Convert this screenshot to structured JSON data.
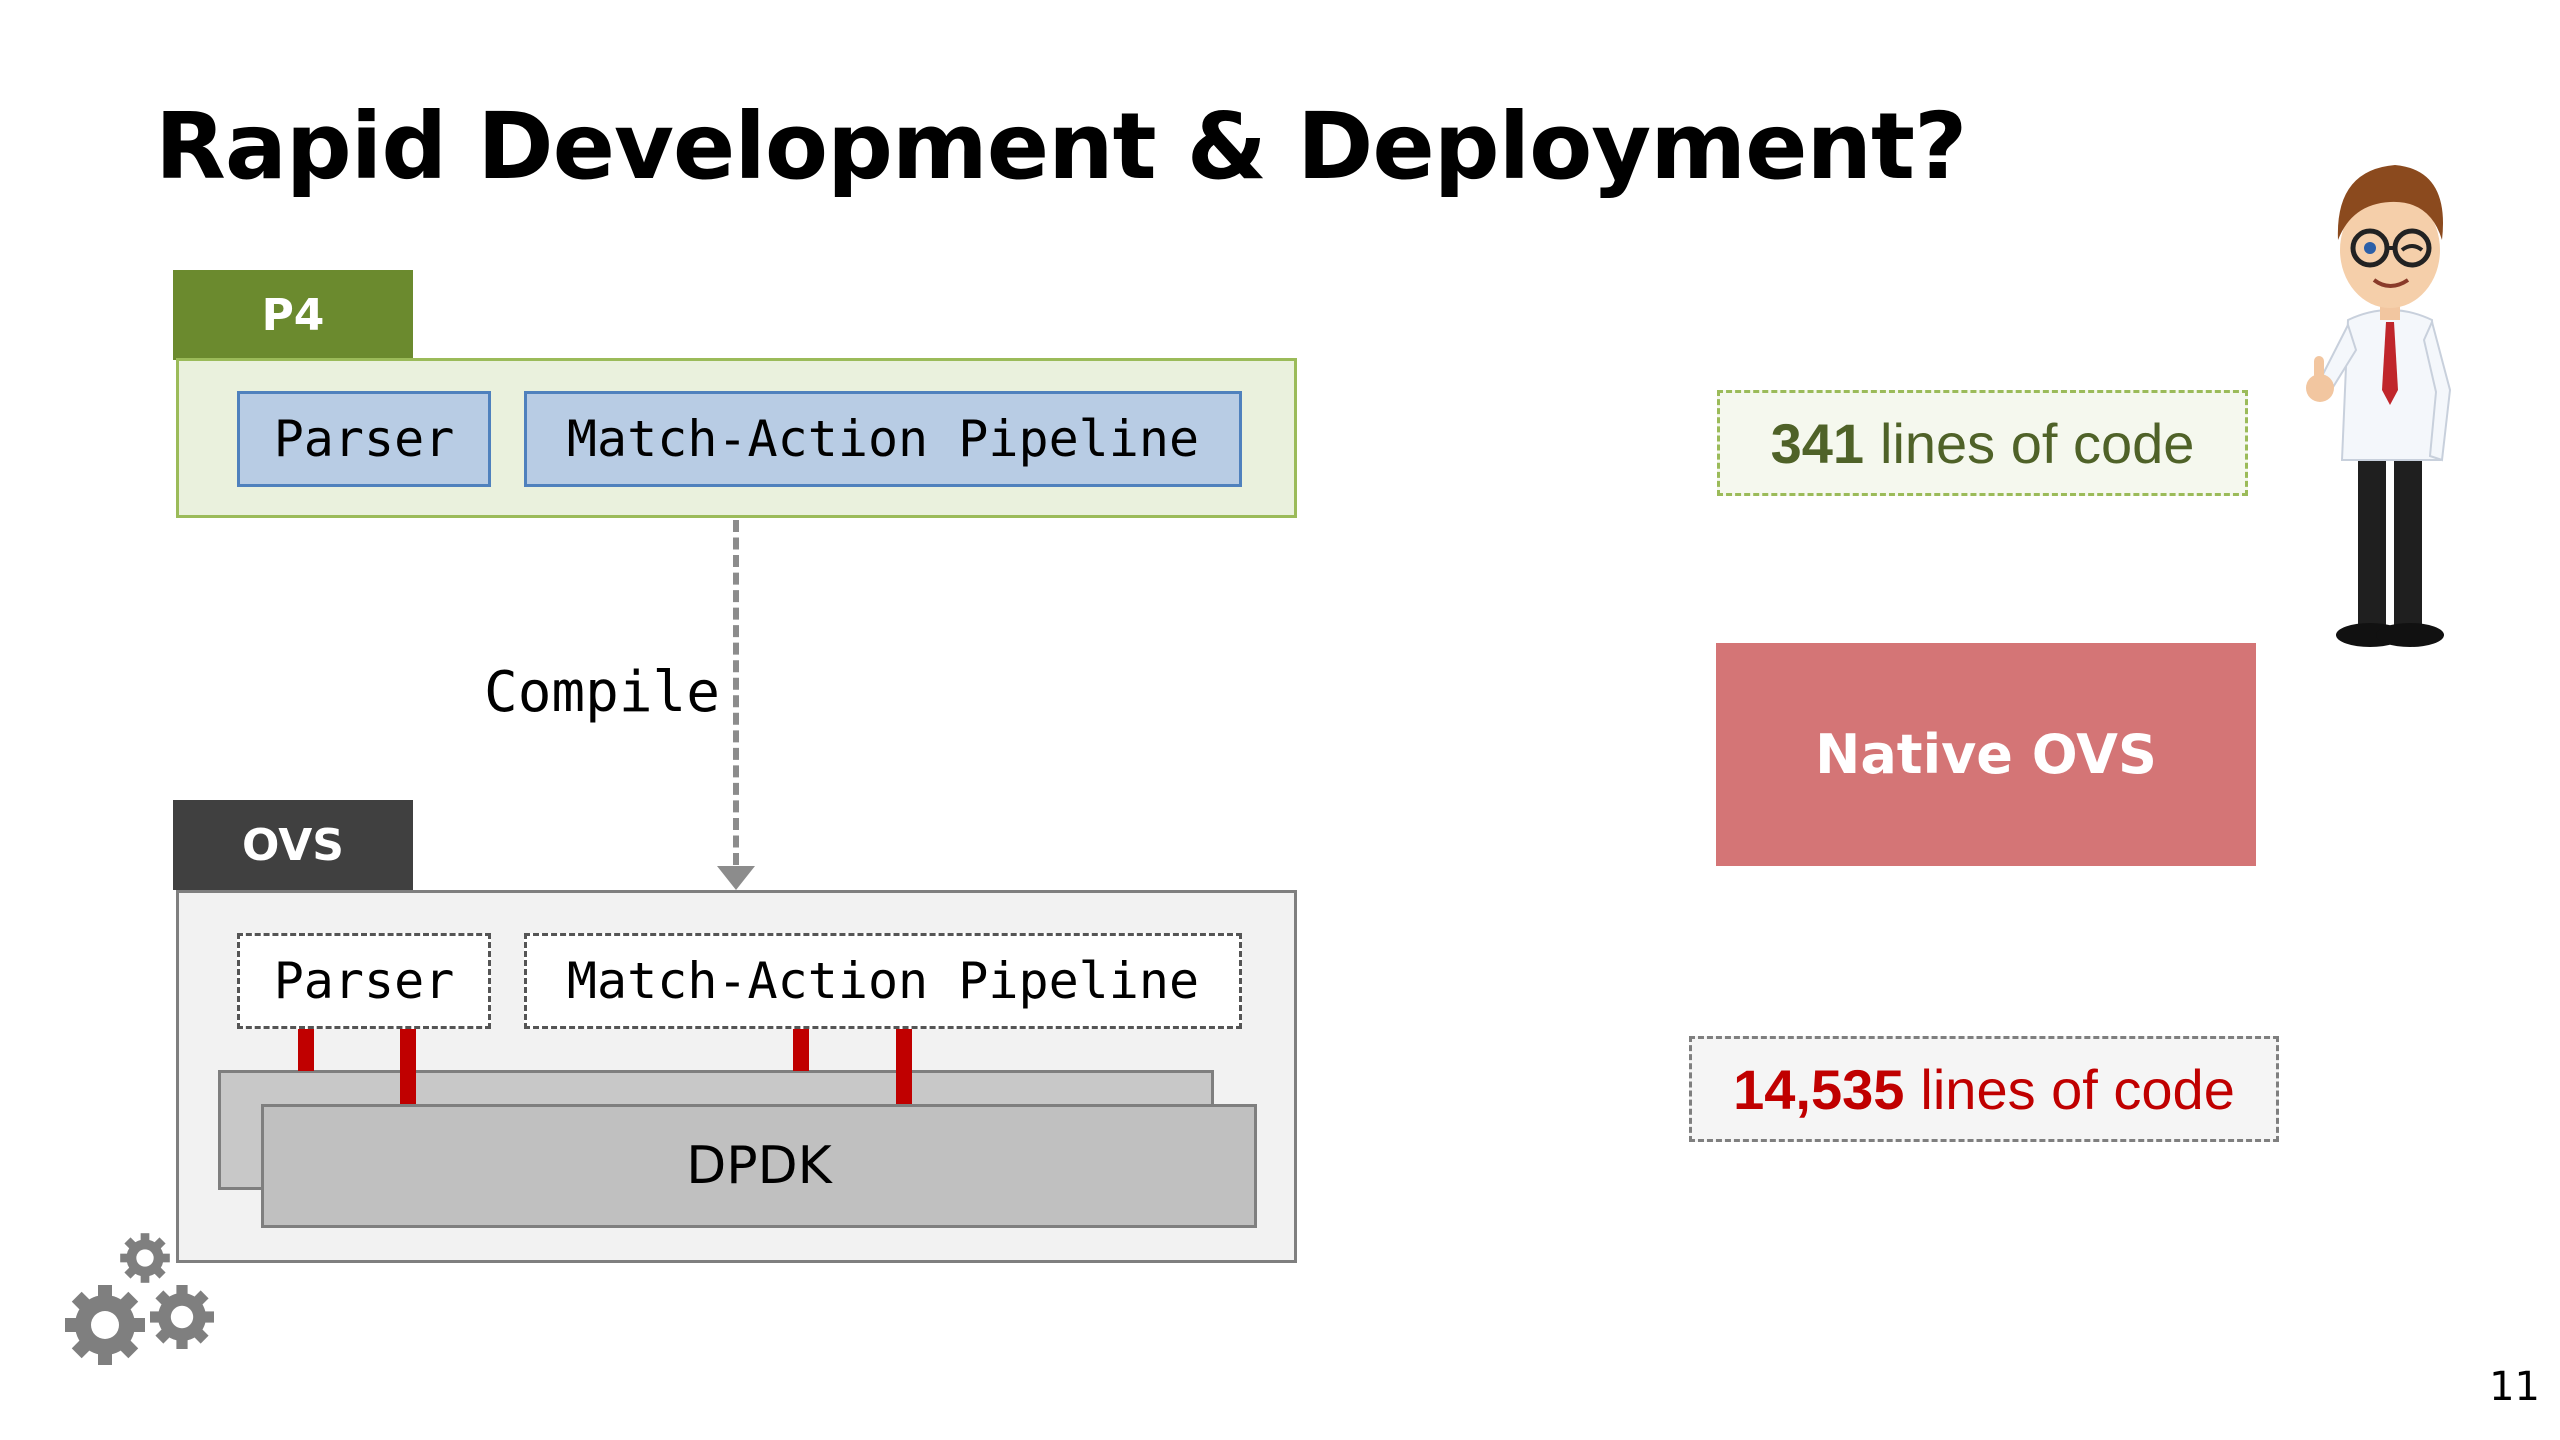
{
  "slide": {
    "title": "Rapid Development & Deployment?",
    "page_number": "11"
  },
  "p4_block": {
    "tab_label": "P4",
    "parser_label": "Parser",
    "pipeline_label": "Match-Action Pipeline"
  },
  "compile": {
    "label": "Compile"
  },
  "ovs_block": {
    "tab_label": "OVS",
    "parser_label": "Parser",
    "pipeline_label": "Match-Action Pipeline",
    "dpdk_label": "DPDK"
  },
  "loc_p4": {
    "number": "341",
    "text": "lines of code"
  },
  "native_ovs": {
    "label": "Native OVS"
  },
  "loc_ovs": {
    "number": "14,535",
    "text": "lines of code"
  },
  "colors": {
    "p4_green": "#6b8a2e",
    "ovs_dark": "#404040",
    "native_ovs_red": "#d47576",
    "loc_ovs_red": "#c00000",
    "stage_blue": "#b8cce4"
  },
  "icons": {
    "gears": "gears-icon",
    "character": "cartoon-man-thumbs-up"
  }
}
